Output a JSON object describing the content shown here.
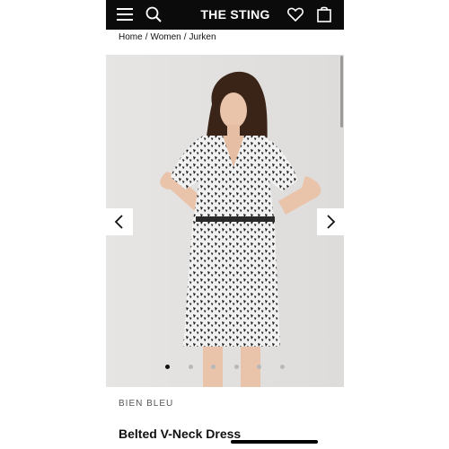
{
  "header": {
    "brand": "THE STING",
    "icons": [
      "menu-icon",
      "search-icon",
      "heart-icon",
      "bag-icon"
    ],
    "background": "#0b0b0b"
  },
  "breadcrumb": {
    "items": [
      "Home",
      "Women",
      "Jurken"
    ],
    "separator": "/"
  },
  "gallery": {
    "image_alt": "Model wearing a black and white printed belted v-neck dress",
    "dots_total": 6,
    "active_dot": 0,
    "prev_icon": "chevron-left-icon",
    "next_icon": "chevron-right-icon"
  },
  "product": {
    "brand": "BIEN BLEU",
    "title": "Belted V-Neck Dress"
  }
}
